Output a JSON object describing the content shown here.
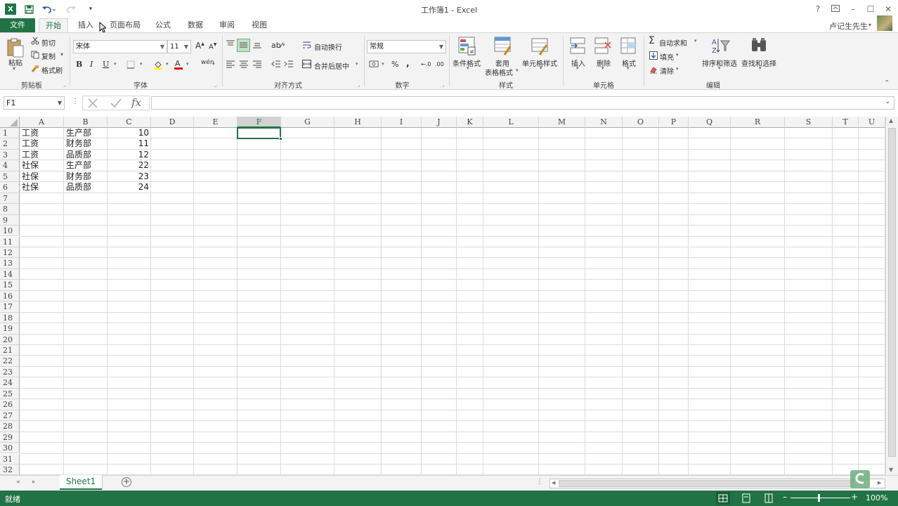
{
  "window": {
    "title": "工作簿1 - Excel",
    "user": "卢记生先生",
    "help": "?"
  },
  "quick_access": {
    "save_icon": "save-icon",
    "undo_icon": "undo-icon",
    "redo_icon": "redo-icon"
  },
  "tabs": [
    {
      "label": "文件"
    },
    {
      "label": "开始"
    },
    {
      "label": "插入"
    },
    {
      "label": "页面布局"
    },
    {
      "label": "公式"
    },
    {
      "label": "数据"
    },
    {
      "label": "审阅"
    },
    {
      "label": "视图"
    }
  ],
  "ribbon": {
    "clipboard": {
      "paste": "粘贴",
      "cut": "剪切",
      "copy": "复制",
      "format_painter": "格式刷",
      "group": "剪贴板"
    },
    "font": {
      "name": "宋体",
      "size": "11",
      "bold": "B",
      "italic": "I",
      "underline": "U",
      "group": "字体"
    },
    "alignment": {
      "wrap": "自动换行",
      "merge": "合并后居中",
      "group": "对齐方式"
    },
    "number": {
      "format": "常规",
      "percent": "%",
      "comma": ",",
      "group": "数字"
    },
    "styles": {
      "conditional": "条件格式",
      "table_line1": "套用",
      "table_line2": "表格格式",
      "cell_styles": "单元格样式",
      "group": "样式"
    },
    "cells": {
      "insert": "插入",
      "delete": "删除",
      "format": "格式",
      "group": "单元格"
    },
    "editing": {
      "autosum": "自动求和",
      "fill": "填充",
      "clear": "清除",
      "sort": "排序和筛选",
      "find": "查找和选择",
      "group": "编辑"
    }
  },
  "formula_bar": {
    "name_box": "F1",
    "fx": "fx",
    "content": ""
  },
  "columns": [
    "A",
    "B",
    "C",
    "D",
    "E",
    "F",
    "G",
    "H",
    "I",
    "J",
    "K",
    "L",
    "M",
    "N",
    "O",
    "P",
    "Q",
    "R",
    "S",
    "T",
    "U"
  ],
  "rows": [
    "1",
    "2",
    "3",
    "4",
    "5",
    "6",
    "7",
    "8",
    "9",
    "10",
    "11",
    "12",
    "13",
    "14",
    "15",
    "16",
    "17",
    "18",
    "19",
    "20",
    "21",
    "22",
    "23",
    "24",
    "25",
    "26",
    "27",
    "28",
    "29",
    "30",
    "31",
    "32"
  ],
  "cells": [
    {
      "a": "工资",
      "b": "生产部",
      "c": "10"
    },
    {
      "a": "工资",
      "b": "财务部",
      "c": "11"
    },
    {
      "a": "工资",
      "b": "品质部",
      "c": "12"
    },
    {
      "a": "社保",
      "b": "生产部",
      "c": "22"
    },
    {
      "a": "社保",
      "b": "财务部",
      "c": "23"
    },
    {
      "a": "社保",
      "b": "品质部",
      "c": "24"
    }
  ],
  "sheets": [
    {
      "label": "Sheet1"
    }
  ],
  "status": {
    "ready": "就绪",
    "zoom": "100%"
  },
  "colors": {
    "accent": "#217346",
    "selection": "#217346"
  }
}
